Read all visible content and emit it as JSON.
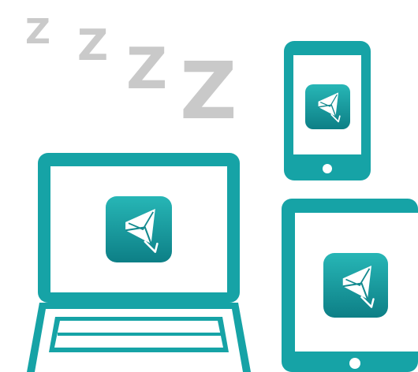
{
  "illustration": {
    "sleep_letters": [
      "Z",
      "Z",
      "Z",
      "Z"
    ],
    "devices": [
      "laptop",
      "phone",
      "tablet"
    ],
    "app_icon": "mail-app-icon",
    "colors": {
      "device_teal": "#16a3a6",
      "screen_white": "#ffffff",
      "letter_grey": "#c9c9c9",
      "icon_gradient_top": "#27b6b6",
      "icon_gradient_bottom": "#0d7f86"
    }
  }
}
